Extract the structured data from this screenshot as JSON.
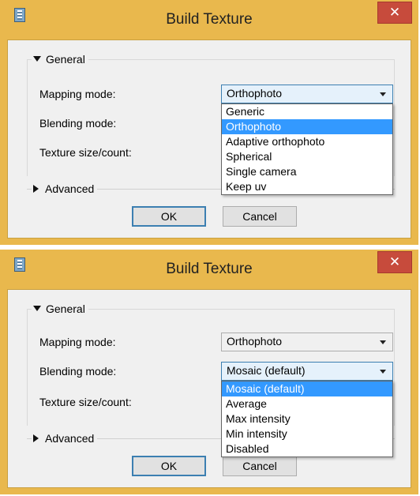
{
  "dialog": {
    "title": "Build Texture",
    "close_glyph": "✕",
    "general_label": "General",
    "advanced_label": "Advanced",
    "mapping_label": "Mapping mode:",
    "blending_label": "Blending mode:",
    "texture_label": "Texture size/count:",
    "ok_label": "OK",
    "cancel_label": "Cancel"
  },
  "top": {
    "mapping_value": "Orthophoto",
    "mapping_options": [
      "Generic",
      "Orthophoto",
      "Adaptive orthophoto",
      "Spherical",
      "Single camera",
      "Keep uv"
    ],
    "selected_index": 1
  },
  "bottom": {
    "mapping_value": "Orthophoto",
    "blending_value": "Mosaic (default)",
    "blending_options": [
      "Mosaic (default)",
      "Average",
      "Max intensity",
      "Min intensity",
      "Disabled"
    ],
    "selected_index": 0
  },
  "colors": {
    "title_bar": "#e9b84d",
    "close_button": "#c74b3c",
    "selection": "#3399ff",
    "focus_border": "#3c7fb1"
  },
  "icons": {
    "app": "film-strip-icon",
    "close": "close-icon",
    "expanded": "triangle-down-icon",
    "collapsed": "triangle-right-icon",
    "combo_arrow": "chevron-down-icon"
  }
}
